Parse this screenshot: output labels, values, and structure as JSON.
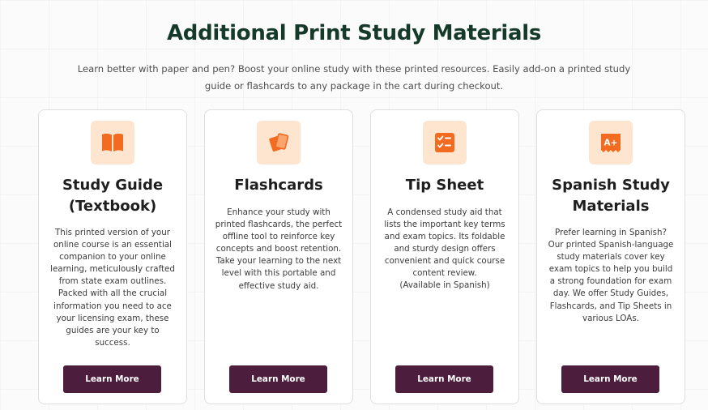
{
  "header": {
    "title": "Additional Print Study Materials",
    "subtitle": "Learn better with paper and pen? Boost your online study with these printed resources. Easily add-on a printed study guide or flashcards to any package in the cart during checkout."
  },
  "cards": [
    {
      "icon": "book-icon",
      "title": "Study Guide (Textbook)",
      "description": "This printed version of your online course is an essential companion to your online learning, meticulously crafted from state exam outlines. Packed with all the crucial information you need to ace your licensing exam, these guides are your key to success.",
      "button": "Learn More"
    },
    {
      "icon": "flashcards-icon",
      "title": "Flashcards",
      "description": "Enhance your study with printed flashcards, the perfect offline tool to reinforce key concepts and boost retention. Take your learning to the next level with this portable and effective study aid.",
      "button": "Learn More"
    },
    {
      "icon": "checklist-icon",
      "title": "Tip Sheet",
      "description": "A condensed study aid that lists the important key terms and exam topics. Its foldable and sturdy design offers convenient and quick course content review.",
      "note": "(Available in Spanish)",
      "button": "Learn More"
    },
    {
      "icon": "grade-a-plus-icon",
      "icon_text": "A+",
      "title": "Spanish Study Materials",
      "description": "Prefer learning in Spanish? Our printed Spanish-language study materials cover key exam topics to help you build a strong foundation for exam day. We offer Study Guides, Flashcards, and Tip Sheets in various LOAs.",
      "button": "Learn More"
    }
  ],
  "colors": {
    "title": "#163a2a",
    "button": "#4d1d3e",
    "icon_bg": "#fde5cf",
    "icon_accent": "#f26b21"
  }
}
